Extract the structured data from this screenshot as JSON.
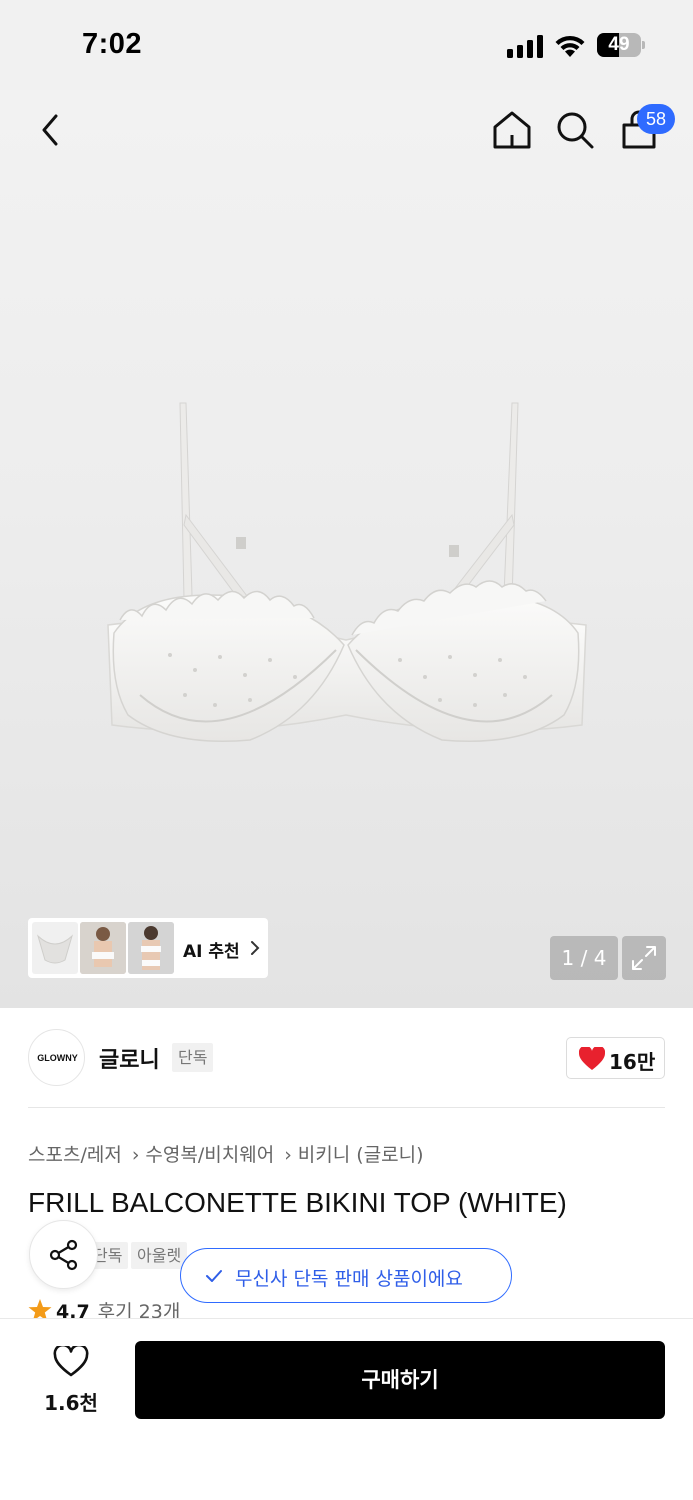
{
  "status_bar": {
    "time": "7:02",
    "battery": "49",
    "battery_level": 0.49,
    "icons": [
      "signal-icon",
      "wifi-icon",
      "battery-icon"
    ]
  },
  "header": {
    "icons": [
      "back-icon",
      "home-icon",
      "search-icon",
      "bag-icon"
    ],
    "cart_count": "58"
  },
  "gallery": {
    "ai_recommend_label": "AI 추천",
    "counter": "1 / 4",
    "expand_icon": "expand-icon"
  },
  "brand": {
    "logo_text": "GLOWNY",
    "name": "글로니",
    "tag": "단독",
    "like_count": "16만",
    "like_color": "#e8212e"
  },
  "breadcrumb": [
    "스포츠/레저",
    "수영복/비치웨어",
    "비키니 (글로니)"
  ],
  "product": {
    "title": "FRILL BALCONETTE BIKINI TOP (WHITE)",
    "tags": [
      "단독",
      "아울렛"
    ],
    "rating": "4.7",
    "review_text": "후기 23개"
  },
  "toast": {
    "text": "무신사 단독 판매 상품이에요",
    "color": "#2f6bff"
  },
  "bottom_bar": {
    "wish_count": "1.6천",
    "buy_label": "구매하기"
  }
}
